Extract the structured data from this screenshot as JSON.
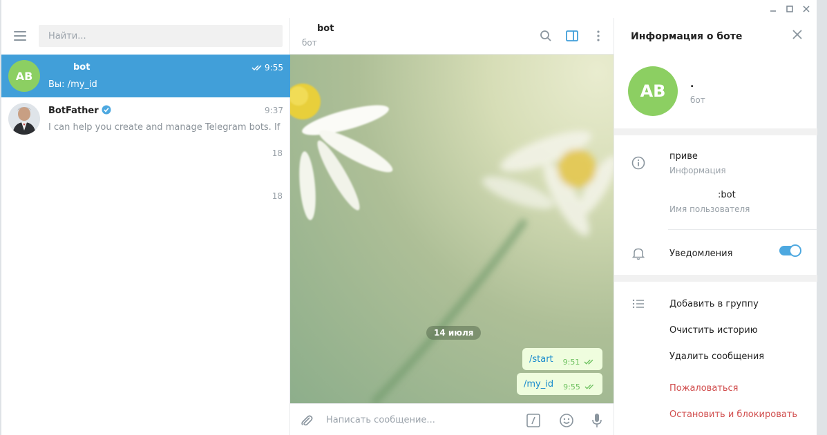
{
  "titlebar": {
    "minimize": "minimize",
    "maximize": "maximize",
    "close": "close"
  },
  "left": {
    "search_placeholder": "Найти...",
    "chats": [
      {
        "avatar": "AB",
        "name_suffix": "bot",
        "time": "9:55",
        "preview": "Вы: /my_id"
      },
      {
        "name": "BotFather",
        "time": "9:37",
        "preview": "I can help you create and manage Telegram bots. If you've"
      }
    ],
    "orphan_numbers": [
      "18",
      "18"
    ]
  },
  "chat": {
    "title_suffix": "bot",
    "subtitle": "бот",
    "date": "14 июля",
    "messages": [
      {
        "text": "/start",
        "time": "9:51"
      },
      {
        "text": "/my_id",
        "time": "9:55"
      }
    ],
    "composer_placeholder": "Написать сообщение..."
  },
  "info": {
    "title": "Информация о боте",
    "avatar": "AB",
    "name": ".",
    "subtitle": "бот",
    "about_value": "приве",
    "about_label": "Информация",
    "username_value": ":bot",
    "username_label": "Имя пользователя",
    "notifications_label": "Уведомления",
    "notifications_on": true,
    "actions": {
      "add_to_group": "Добавить в группу",
      "clear_history": "Очистить историю",
      "delete_messages": "Удалить сообщения",
      "report": "Пожаловаться",
      "stop_block": "Остановить и блокировать"
    }
  },
  "colors": {
    "accent": "#419fd9",
    "avatar": "#8ccf62",
    "bubble": "#effdde",
    "danger": "#d14e4e"
  }
}
